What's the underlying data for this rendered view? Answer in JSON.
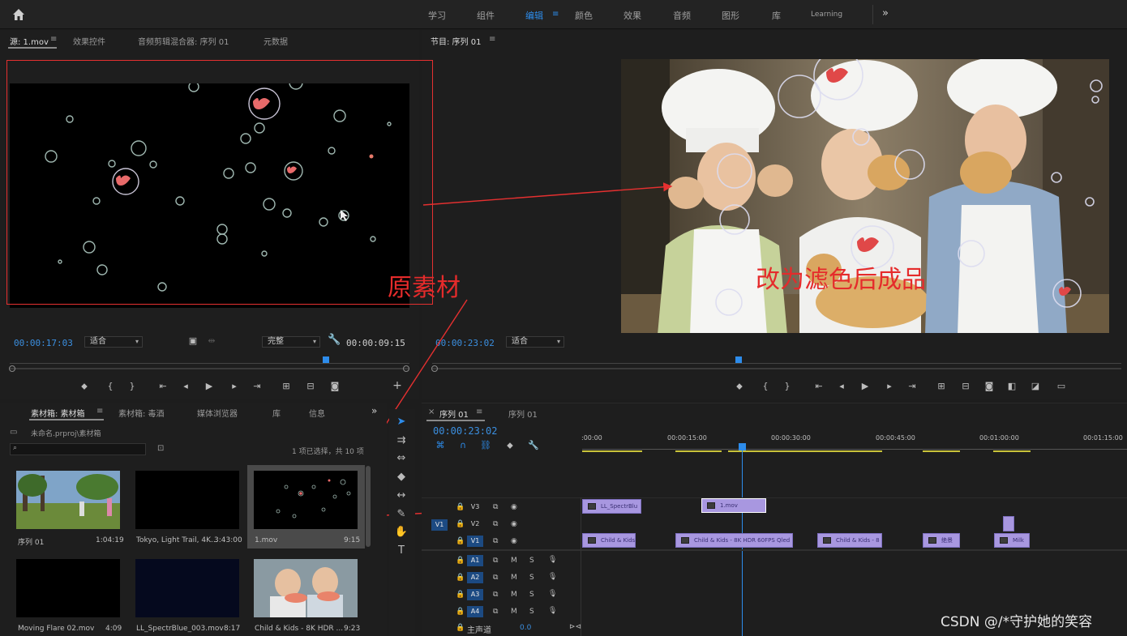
{
  "workspace": {
    "tabs": [
      "学习",
      "组件",
      "编辑",
      "颜色",
      "效果",
      "音频",
      "图形",
      "库",
      "Learning"
    ],
    "active_index": 2,
    "more": "»"
  },
  "source_panel": {
    "tabs": [
      "源: 1.mov",
      "效果控件",
      "音频剪辑混合器: 序列 01",
      "元数据"
    ],
    "menu": "≡",
    "timecode": "00:00:17:03",
    "fit": "适合",
    "quality": "完整",
    "duration": "00:00:09:15"
  },
  "program_panel": {
    "title": "节目: 序列 01",
    "menu": "≡",
    "timecode": "00:00:23:02",
    "fit": "适合"
  },
  "annotations": {
    "original": "原素材",
    "result": "改为滤色后成品"
  },
  "project_panel": {
    "tabs": [
      "素材箱: 素材箱",
      "素材箱: 毒酒",
      "媒体浏览器",
      "库",
      "信息"
    ],
    "menu": "≡",
    "path": "未命名.prproj\\素材箱",
    "selection": "1 项已选择，共 10 项",
    "items": [
      {
        "name": "序列 01",
        "duration": "1:04:19"
      },
      {
        "name": "Tokyo, Light Trail, 4K...",
        "duration": "3:43:00"
      },
      {
        "name": "1.mov",
        "duration": "9:15"
      },
      {
        "name": "Moving Flare 02.mov",
        "duration": "4:09"
      },
      {
        "name": "LL_SpectrBlue_003.mov",
        "duration": "8:17"
      },
      {
        "name": "Child & Kids - 8K HDR ...",
        "duration": "9:23"
      }
    ]
  },
  "timeline": {
    "tabs": [
      "序列 01",
      "序列 01"
    ],
    "close": "×",
    "menu": "≡",
    "timecode": "00:00:23:02",
    "ruler": [
      ":00:00",
      "00:00:15:00",
      "00:00:30:00",
      "00:00:45:00",
      "00:01:00:00",
      "00:01:15:00"
    ],
    "video_tracks": [
      "V3",
      "V2",
      "V1"
    ],
    "audio_tracks": [
      "A1",
      "A2",
      "A3",
      "A4"
    ],
    "source_patch": "V1",
    "master": "主声道",
    "master_value": "0.0",
    "clips_v3": [
      {
        "label": "LL_SpectrBlu"
      },
      {
        "label": "1.mov"
      }
    ],
    "clips_v1": [
      {
        "label": "Child & Kids"
      },
      {
        "label": "Child & Kids - 8K HDR 60FPS Qled"
      },
      {
        "label": "Child & Kids - 8"
      },
      {
        "label": "绝景"
      },
      {
        "label": "Milk"
      }
    ],
    "mute": "M",
    "solo": "S"
  },
  "watermark": "CSDN @/*守护她的笑容",
  "colors": {
    "accent": "#2d8ceb",
    "annotation": "#e52b2b",
    "clip": "#a897e0"
  }
}
